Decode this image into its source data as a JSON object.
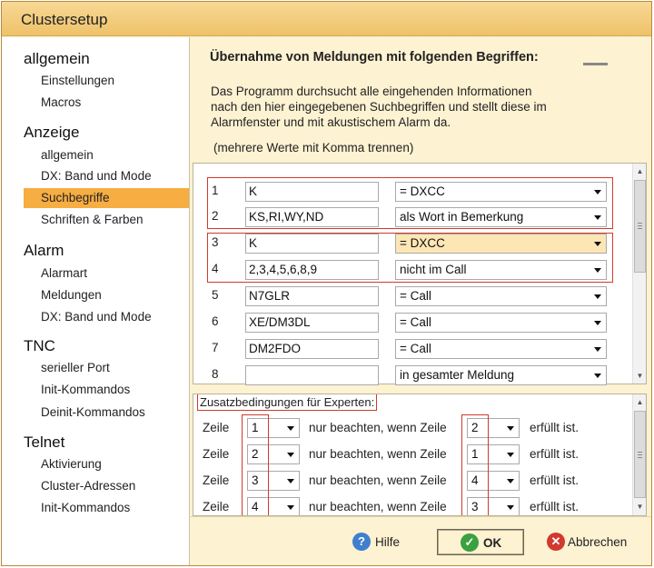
{
  "window": {
    "title": "Clustersetup"
  },
  "sidebar": {
    "groups": [
      {
        "label": "allgemein",
        "items": [
          "Einstellungen",
          "Macros"
        ]
      },
      {
        "label": "Anzeige",
        "items": [
          "allgemein",
          "DX: Band und Mode",
          "Suchbegriffe",
          "Schriften & Farben"
        ]
      },
      {
        "label": "Alarm",
        "items": [
          "Alarmart",
          "Meldungen",
          "DX: Band und Mode"
        ]
      },
      {
        "label": "TNC",
        "items": [
          "serieller Port",
          "Init-Kommandos",
          "Deinit-Kommandos"
        ]
      },
      {
        "label": "Telnet",
        "items": [
          "Aktivierung",
          "Cluster-Adressen",
          "Init-Kommandos"
        ]
      }
    ],
    "selected": "Suchbegriffe"
  },
  "content": {
    "heading": "Übernahme von Meldungen mit folgenden Begriffen:",
    "description": [
      "Das Programm durchsucht alle eingehenden Informationen",
      "nach den hier eingegebenen Suchbegriffen und stellt diese im",
      "Alarmfenster und mit akustischem Alarm da."
    ],
    "hint": "(mehrere Werte mit Komma trennen)",
    "rows": [
      {
        "n": "1",
        "value": "K",
        "match": "= DXCC"
      },
      {
        "n": "2",
        "value": "KS,RI,WY,ND",
        "match": "als Wort in Bemerkung"
      },
      {
        "n": "3",
        "value": "K",
        "match": "= DXCC"
      },
      {
        "n": "4",
        "value": "2,3,4,5,6,8,9",
        "match": "nicht im Call"
      },
      {
        "n": "5",
        "value": "N7GLR",
        "match": "= Call"
      },
      {
        "n": "6",
        "value": "XE/DM3DL",
        "match": "= Call"
      },
      {
        "n": "7",
        "value": "DM2FDO",
        "match": "= Call"
      },
      {
        "n": "8",
        "value": "",
        "match": "in gesamter Meldung"
      }
    ],
    "expert": {
      "label": "Zusatzbedingungen für Experten:",
      "zeile": "Zeile",
      "mid": "nur beachten, wenn Zeile",
      "end": "erfüllt ist.",
      "rows": [
        {
          "a": "1",
          "b": "2"
        },
        {
          "a": "2",
          "b": "1"
        },
        {
          "a": "3",
          "b": "4"
        },
        {
          "a": "4",
          "b": "3"
        }
      ]
    }
  },
  "buttons": {
    "help": "Hilfe",
    "ok": "OK",
    "cancel": "Abbrechen"
  },
  "colors": {
    "title": "#eec26a",
    "selected": "#f6ad42",
    "content_bg": "#fdf2d2",
    "highlight": "#d23a2a"
  }
}
